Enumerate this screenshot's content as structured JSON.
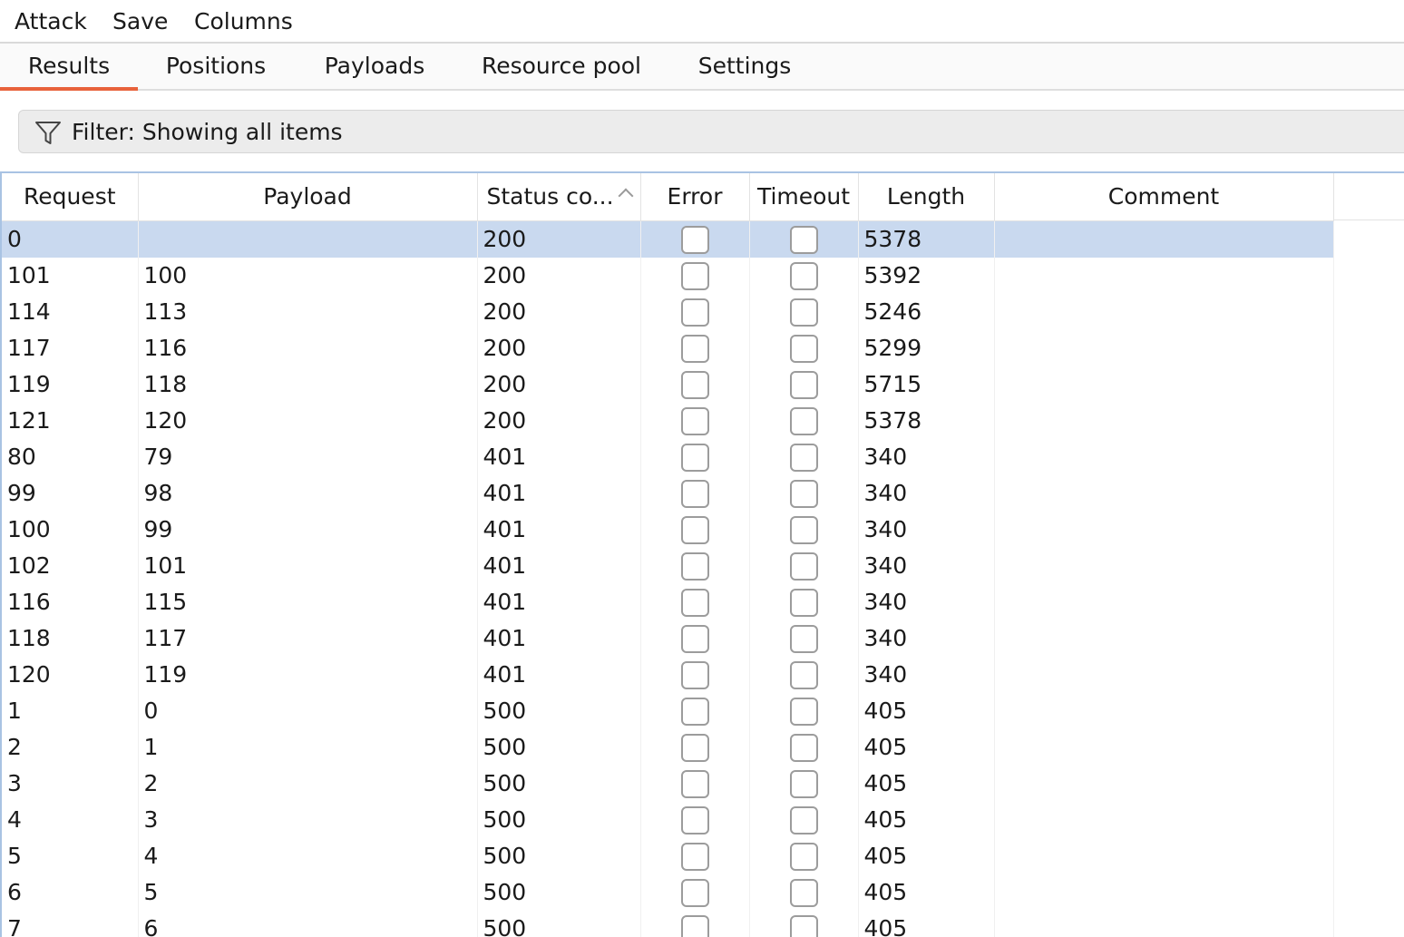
{
  "menu": {
    "attack": "Attack",
    "save": "Save",
    "columns": "Columns"
  },
  "tabs": [
    {
      "label": "Results",
      "active": true
    },
    {
      "label": "Positions",
      "active": false
    },
    {
      "label": "Payloads",
      "active": false
    },
    {
      "label": "Resource pool",
      "active": false
    },
    {
      "label": "Settings",
      "active": false
    }
  ],
  "filter": {
    "icon": "filter-funnel-icon",
    "text": "Filter: Showing all items"
  },
  "table": {
    "headers": {
      "request": "Request",
      "payload": "Payload",
      "status": "Status co...",
      "error": "Error",
      "timeout": "Timeout",
      "length": "Length",
      "comment": "Comment"
    },
    "sort": {
      "column": "status",
      "direction": "ascending"
    },
    "selected_row": 0,
    "rows": [
      {
        "request": "0",
        "payload": "",
        "status": "200",
        "error": false,
        "timeout": false,
        "length": "5378",
        "comment": ""
      },
      {
        "request": "101",
        "payload": "100",
        "status": "200",
        "error": false,
        "timeout": false,
        "length": "5392",
        "comment": ""
      },
      {
        "request": "114",
        "payload": "113",
        "status": "200",
        "error": false,
        "timeout": false,
        "length": "5246",
        "comment": ""
      },
      {
        "request": "117",
        "payload": "116",
        "status": "200",
        "error": false,
        "timeout": false,
        "length": "5299",
        "comment": ""
      },
      {
        "request": "119",
        "payload": "118",
        "status": "200",
        "error": false,
        "timeout": false,
        "length": "5715",
        "comment": ""
      },
      {
        "request": "121",
        "payload": "120",
        "status": "200",
        "error": false,
        "timeout": false,
        "length": "5378",
        "comment": ""
      },
      {
        "request": "80",
        "payload": "79",
        "status": "401",
        "error": false,
        "timeout": false,
        "length": "340",
        "comment": ""
      },
      {
        "request": "99",
        "payload": "98",
        "status": "401",
        "error": false,
        "timeout": false,
        "length": "340",
        "comment": ""
      },
      {
        "request": "100",
        "payload": "99",
        "status": "401",
        "error": false,
        "timeout": false,
        "length": "340",
        "comment": ""
      },
      {
        "request": "102",
        "payload": "101",
        "status": "401",
        "error": false,
        "timeout": false,
        "length": "340",
        "comment": ""
      },
      {
        "request": "116",
        "payload": "115",
        "status": "401",
        "error": false,
        "timeout": false,
        "length": "340",
        "comment": ""
      },
      {
        "request": "118",
        "payload": "117",
        "status": "401",
        "error": false,
        "timeout": false,
        "length": "340",
        "comment": ""
      },
      {
        "request": "120",
        "payload": "119",
        "status": "401",
        "error": false,
        "timeout": false,
        "length": "340",
        "comment": ""
      },
      {
        "request": "1",
        "payload": "0",
        "status": "500",
        "error": false,
        "timeout": false,
        "length": "405",
        "comment": ""
      },
      {
        "request": "2",
        "payload": "1",
        "status": "500",
        "error": false,
        "timeout": false,
        "length": "405",
        "comment": ""
      },
      {
        "request": "3",
        "payload": "2",
        "status": "500",
        "error": false,
        "timeout": false,
        "length": "405",
        "comment": ""
      },
      {
        "request": "4",
        "payload": "3",
        "status": "500",
        "error": false,
        "timeout": false,
        "length": "405",
        "comment": ""
      },
      {
        "request": "5",
        "payload": "4",
        "status": "500",
        "error": false,
        "timeout": false,
        "length": "405",
        "comment": ""
      },
      {
        "request": "6",
        "payload": "5",
        "status": "500",
        "error": false,
        "timeout": false,
        "length": "405",
        "comment": ""
      },
      {
        "request": "7",
        "payload": "6",
        "status": "500",
        "error": false,
        "timeout": false,
        "length": "405",
        "comment": ""
      }
    ]
  },
  "colors": {
    "accent": "#e8623b",
    "selection": "#c9d9ef",
    "table_border": "#a9c3e3"
  }
}
